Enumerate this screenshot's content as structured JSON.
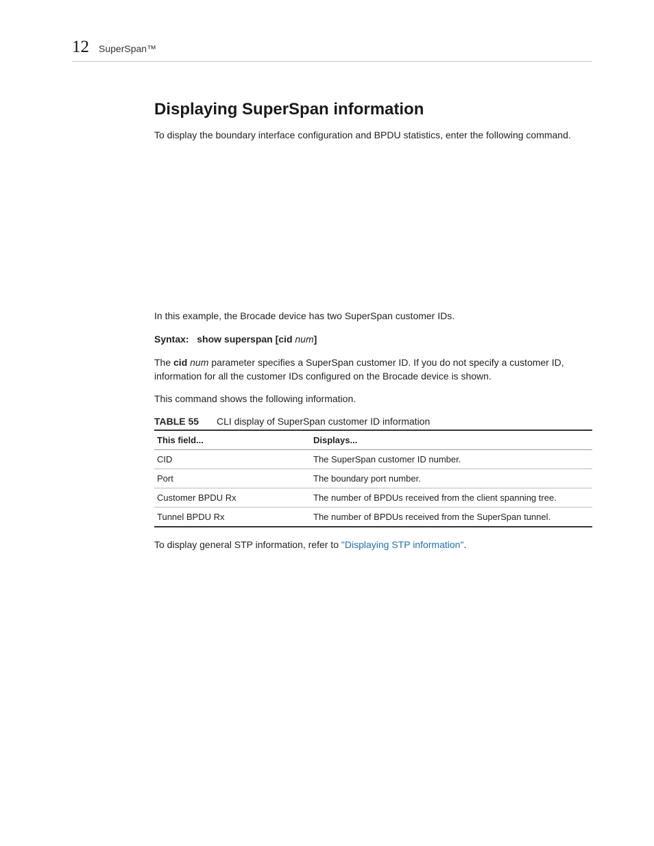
{
  "header": {
    "chapter_number": "12",
    "chapter_title": "SuperSpan™"
  },
  "main": {
    "heading": "Displaying SuperSpan information",
    "intro": "To display the boundary interface configuration and BPDU statistics, enter the following command.",
    "example_note": "In this example, the Brocade device has two SuperSpan customer IDs.",
    "syntax": {
      "label": "Syntax:",
      "cmd_prefix": "show superspan [cid ",
      "cmd_var": "num",
      "cmd_suffix": "]"
    },
    "param_line": {
      "p1": "The ",
      "cid": "cid",
      "space": " ",
      "num": "num",
      "p2": " parameter specifies a SuperSpan customer ID. If you do not specify a customer ID, information for all the customer IDs configured on the Brocade device is shown."
    },
    "shows_line": "This command shows the following information.",
    "table": {
      "label": "TABLE 55",
      "caption": "CLI display of SuperSpan customer ID information",
      "head": {
        "c1": "This field...",
        "c2": "Displays..."
      },
      "rows": [
        {
          "c1": "CID",
          "c2": "The SuperSpan customer ID number."
        },
        {
          "c1": "Port",
          "c2": "The boundary port number."
        },
        {
          "c1": "Customer BPDU Rx",
          "c2": "The number of BPDUs received from the client spanning tree."
        },
        {
          "c1": "Tunnel BPDU Rx",
          "c2": "The number of BPDUs received from the SuperSpan tunnel."
        }
      ]
    },
    "footer_line": {
      "p1": "To display general STP information, refer to ",
      "link": "\"Displaying STP information\"",
      "p2": "."
    }
  }
}
